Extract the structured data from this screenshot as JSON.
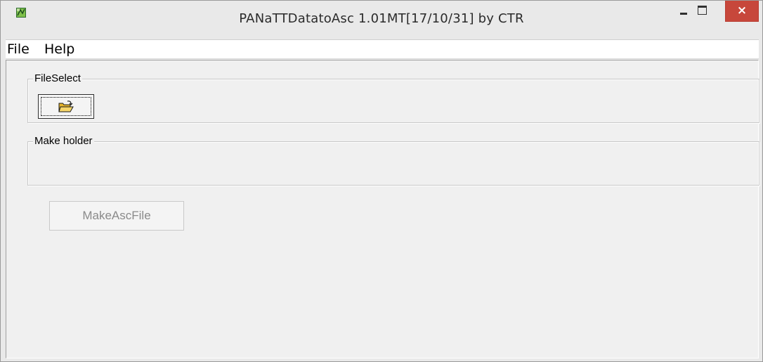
{
  "window": {
    "title": "PANaTTDatatoAsc 1.01MT[17/10/31] by CTR",
    "icon": "app-icon",
    "controls": {
      "minimize_icon": "minimize-icon",
      "maximize_icon": "maximize-icon",
      "close_glyph": "×"
    },
    "colors": {
      "close_button": "#c7473b",
      "titlebar": "#e9e9e9",
      "client": "#f0f0f0"
    }
  },
  "menu": {
    "items": [
      {
        "label": "File"
      },
      {
        "label": "Help"
      }
    ]
  },
  "groups": {
    "file_select": {
      "label": "FileSelect",
      "open_button_icon": "open-folder-icon"
    },
    "make_holder": {
      "label": "Make holder"
    }
  },
  "actions": {
    "make_asc_file": {
      "label": "MakeAscFile",
      "enabled": false
    }
  }
}
